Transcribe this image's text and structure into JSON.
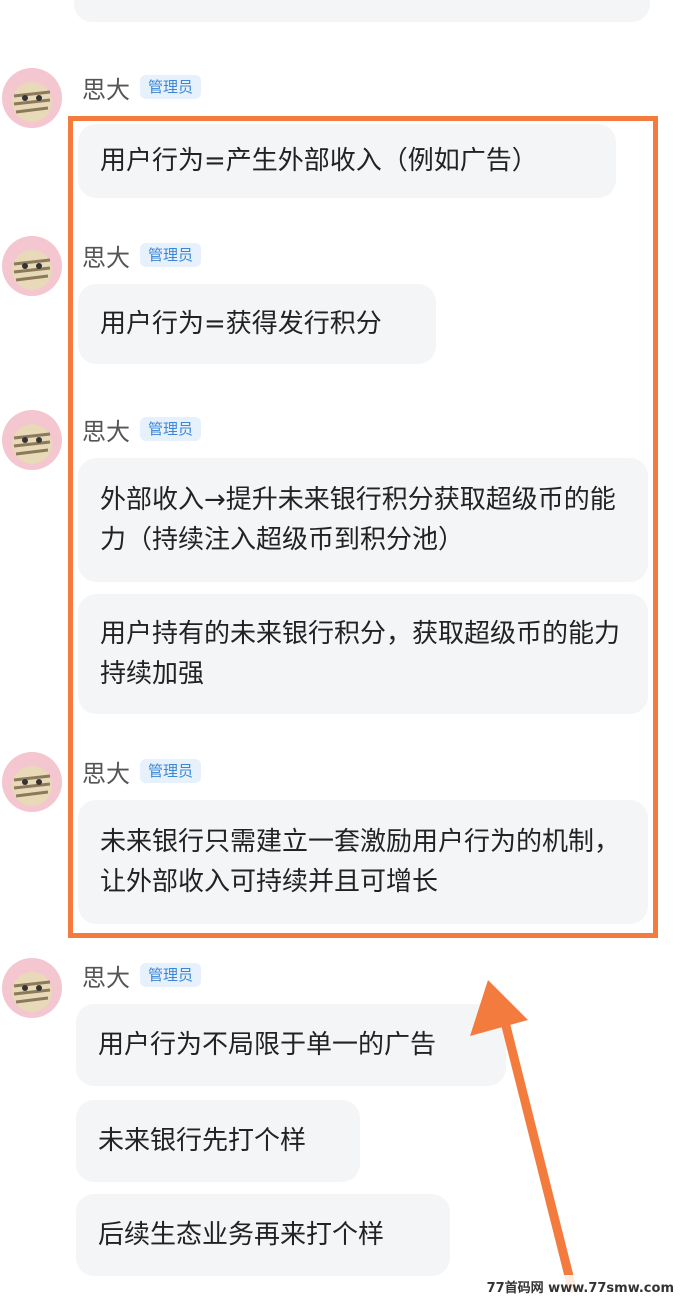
{
  "messages": [
    {
      "sender": "思大",
      "badge": "管理员",
      "bubbles": [
        "用户行为=产生外部收入（例如广告）"
      ]
    },
    {
      "sender": "思大",
      "badge": "管理员",
      "bubbles": [
        "用户行为=获得发行积分"
      ]
    },
    {
      "sender": "思大",
      "badge": "管理员",
      "bubbles": [
        "外部收入→提升未来银行积分获取超级币的能力（持续注入超级币到积分池）",
        "用户持有的未来银行积分，获取超级币的能力持续加强"
      ]
    },
    {
      "sender": "思大",
      "badge": "管理员",
      "bubbles": [
        "未来银行只需建立一套激励用户行为的机制，让外部收入可持续并且可增长"
      ]
    },
    {
      "sender": "思大",
      "badge": "管理员",
      "bubbles": [
        "用户行为不局限于单一的广告",
        "未来银行先打个样",
        "后续生态业务再来打个样"
      ]
    }
  ],
  "annotation": {
    "color": "#f37b3d"
  },
  "watermark": "77首码网 www.77smw.com"
}
